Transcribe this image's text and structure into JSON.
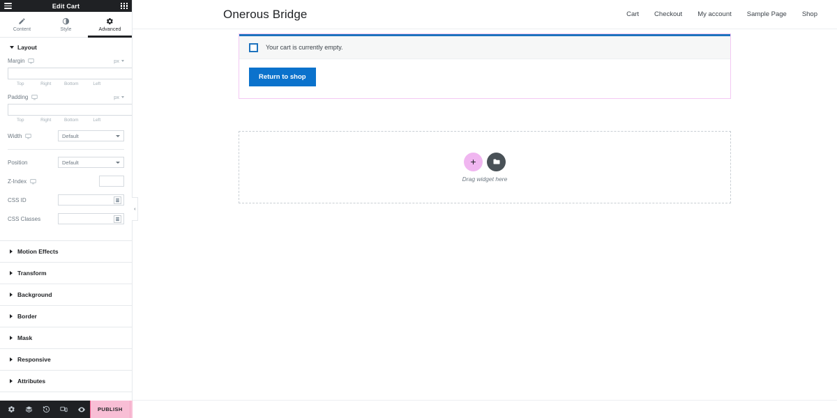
{
  "panel": {
    "header": {
      "title": "Edit Cart",
      "menu_icon": "hamburger-icon",
      "widgets_icon": "grid-icon"
    },
    "tabs": [
      {
        "label": "Content",
        "icon": "pencil-icon",
        "active": false
      },
      {
        "label": "Style",
        "icon": "contrast-icon",
        "active": false
      },
      {
        "label": "Advanced",
        "icon": "gear-icon",
        "active": true
      }
    ],
    "layout_section": {
      "title": "Layout",
      "margin": {
        "label": "Margin",
        "unit": "px",
        "values": [
          "",
          "",
          "",
          ""
        ],
        "sides": [
          "Top",
          "Right",
          "Bottom",
          "Left"
        ],
        "link_icon": "link-icon"
      },
      "padding": {
        "label": "Padding",
        "unit": "px",
        "values": [
          "",
          "",
          "",
          ""
        ],
        "sides": [
          "Top",
          "Right",
          "Bottom",
          "Left"
        ],
        "link_icon": "link-icon"
      },
      "width": {
        "label": "Width",
        "value": "Default"
      },
      "position": {
        "label": "Position",
        "value": "Default"
      },
      "z_index": {
        "label": "Z-Index",
        "value": ""
      },
      "css_id": {
        "label": "CSS ID",
        "value": ""
      },
      "css_classes": {
        "label": "CSS Classes",
        "value": ""
      }
    },
    "accordions": [
      {
        "label": "Motion Effects"
      },
      {
        "label": "Transform"
      },
      {
        "label": "Background"
      },
      {
        "label": "Border"
      },
      {
        "label": "Mask"
      },
      {
        "label": "Responsive"
      },
      {
        "label": "Attributes"
      }
    ],
    "footer": {
      "tools": [
        {
          "name": "settings-icon"
        },
        {
          "name": "navigator-icon"
        },
        {
          "name": "history-icon"
        },
        {
          "name": "responsive-mode-icon"
        },
        {
          "name": "preview-icon"
        }
      ],
      "publish_label": "PUBLISH",
      "publish_color": "#f8bed5",
      "publish_arrow_icon": "chevron-up-icon"
    },
    "collapse_icon": "chevron-left-icon"
  },
  "canvas": {
    "site_header": {
      "title": "Onerous Bridge",
      "nav": [
        {
          "label": "Cart"
        },
        {
          "label": "Checkout"
        },
        {
          "label": "My account"
        },
        {
          "label": "Sample Page"
        },
        {
          "label": "Shop"
        }
      ]
    },
    "cart": {
      "accent_color": "#1e73be",
      "selection_color": "#f3c8f3",
      "notice_icon": "info-square-icon",
      "notice_text": "Your cart is currently empty.",
      "return_button": "Return to shop",
      "return_button_color": "#0b72cc"
    },
    "dropzone": {
      "add_icon": "plus-icon",
      "template_icon": "folder-icon",
      "text": "Drag widget here",
      "add_color": "#f0b6f0",
      "template_color": "#495157"
    }
  }
}
